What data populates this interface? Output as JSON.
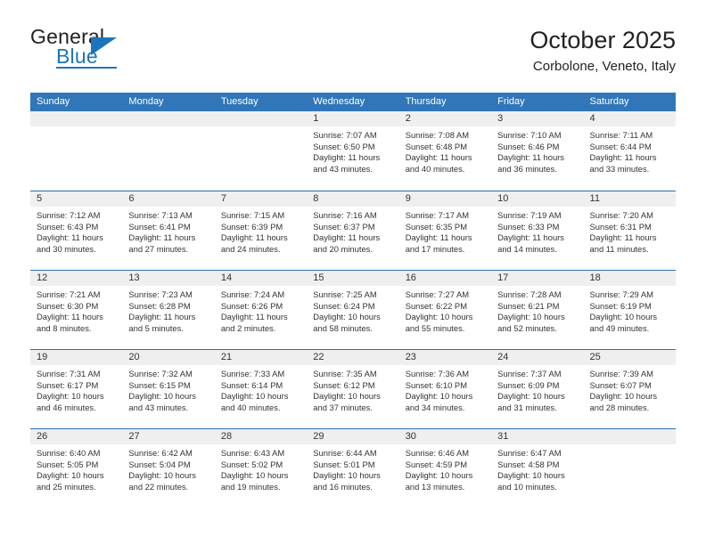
{
  "brand": {
    "name_part1": "General",
    "name_part2": "Blue",
    "triangle_icon": "triangle-icon",
    "accent_color": "#1c75bc"
  },
  "header": {
    "title": "October 2025",
    "subtitle": "Corbolone, Veneto, Italy"
  },
  "colors": {
    "weekday_header_bg": "#3076b8",
    "weekday_header_text": "#ffffff",
    "day_number_bg": "#efefef",
    "row_separator": "#2f6fa8",
    "body_text": "#333333"
  },
  "weekdays": [
    "Sunday",
    "Monday",
    "Tuesday",
    "Wednesday",
    "Thursday",
    "Friday",
    "Saturday"
  ],
  "weeks": [
    [
      {
        "day": "",
        "sunrise": "",
        "sunset": "",
        "daylight": "",
        "empty": true
      },
      {
        "day": "",
        "sunrise": "",
        "sunset": "",
        "daylight": "",
        "empty": true
      },
      {
        "day": "",
        "sunrise": "",
        "sunset": "",
        "daylight": "",
        "empty": true
      },
      {
        "day": "1",
        "sunrise": "Sunrise: 7:07 AM",
        "sunset": "Sunset: 6:50 PM",
        "daylight": "Daylight: 11 hours and 43 minutes."
      },
      {
        "day": "2",
        "sunrise": "Sunrise: 7:08 AM",
        "sunset": "Sunset: 6:48 PM",
        "daylight": "Daylight: 11 hours and 40 minutes."
      },
      {
        "day": "3",
        "sunrise": "Sunrise: 7:10 AM",
        "sunset": "Sunset: 6:46 PM",
        "daylight": "Daylight: 11 hours and 36 minutes."
      },
      {
        "day": "4",
        "sunrise": "Sunrise: 7:11 AM",
        "sunset": "Sunset: 6:44 PM",
        "daylight": "Daylight: 11 hours and 33 minutes."
      }
    ],
    [
      {
        "day": "5",
        "sunrise": "Sunrise: 7:12 AM",
        "sunset": "Sunset: 6:43 PM",
        "daylight": "Daylight: 11 hours and 30 minutes."
      },
      {
        "day": "6",
        "sunrise": "Sunrise: 7:13 AM",
        "sunset": "Sunset: 6:41 PM",
        "daylight": "Daylight: 11 hours and 27 minutes."
      },
      {
        "day": "7",
        "sunrise": "Sunrise: 7:15 AM",
        "sunset": "Sunset: 6:39 PM",
        "daylight": "Daylight: 11 hours and 24 minutes."
      },
      {
        "day": "8",
        "sunrise": "Sunrise: 7:16 AM",
        "sunset": "Sunset: 6:37 PM",
        "daylight": "Daylight: 11 hours and 20 minutes."
      },
      {
        "day": "9",
        "sunrise": "Sunrise: 7:17 AM",
        "sunset": "Sunset: 6:35 PM",
        "daylight": "Daylight: 11 hours and 17 minutes."
      },
      {
        "day": "10",
        "sunrise": "Sunrise: 7:19 AM",
        "sunset": "Sunset: 6:33 PM",
        "daylight": "Daylight: 11 hours and 14 minutes."
      },
      {
        "day": "11",
        "sunrise": "Sunrise: 7:20 AM",
        "sunset": "Sunset: 6:31 PM",
        "daylight": "Daylight: 11 hours and 11 minutes."
      }
    ],
    [
      {
        "day": "12",
        "sunrise": "Sunrise: 7:21 AM",
        "sunset": "Sunset: 6:30 PM",
        "daylight": "Daylight: 11 hours and 8 minutes."
      },
      {
        "day": "13",
        "sunrise": "Sunrise: 7:23 AM",
        "sunset": "Sunset: 6:28 PM",
        "daylight": "Daylight: 11 hours and 5 minutes."
      },
      {
        "day": "14",
        "sunrise": "Sunrise: 7:24 AM",
        "sunset": "Sunset: 6:26 PM",
        "daylight": "Daylight: 11 hours and 2 minutes."
      },
      {
        "day": "15",
        "sunrise": "Sunrise: 7:25 AM",
        "sunset": "Sunset: 6:24 PM",
        "daylight": "Daylight: 10 hours and 58 minutes."
      },
      {
        "day": "16",
        "sunrise": "Sunrise: 7:27 AM",
        "sunset": "Sunset: 6:22 PM",
        "daylight": "Daylight: 10 hours and 55 minutes."
      },
      {
        "day": "17",
        "sunrise": "Sunrise: 7:28 AM",
        "sunset": "Sunset: 6:21 PM",
        "daylight": "Daylight: 10 hours and 52 minutes."
      },
      {
        "day": "18",
        "sunrise": "Sunrise: 7:29 AM",
        "sunset": "Sunset: 6:19 PM",
        "daylight": "Daylight: 10 hours and 49 minutes."
      }
    ],
    [
      {
        "day": "19",
        "sunrise": "Sunrise: 7:31 AM",
        "sunset": "Sunset: 6:17 PM",
        "daylight": "Daylight: 10 hours and 46 minutes."
      },
      {
        "day": "20",
        "sunrise": "Sunrise: 7:32 AM",
        "sunset": "Sunset: 6:15 PM",
        "daylight": "Daylight: 10 hours and 43 minutes."
      },
      {
        "day": "21",
        "sunrise": "Sunrise: 7:33 AM",
        "sunset": "Sunset: 6:14 PM",
        "daylight": "Daylight: 10 hours and 40 minutes."
      },
      {
        "day": "22",
        "sunrise": "Sunrise: 7:35 AM",
        "sunset": "Sunset: 6:12 PM",
        "daylight": "Daylight: 10 hours and 37 minutes."
      },
      {
        "day": "23",
        "sunrise": "Sunrise: 7:36 AM",
        "sunset": "Sunset: 6:10 PM",
        "daylight": "Daylight: 10 hours and 34 minutes."
      },
      {
        "day": "24",
        "sunrise": "Sunrise: 7:37 AM",
        "sunset": "Sunset: 6:09 PM",
        "daylight": "Daylight: 10 hours and 31 minutes."
      },
      {
        "day": "25",
        "sunrise": "Sunrise: 7:39 AM",
        "sunset": "Sunset: 6:07 PM",
        "daylight": "Daylight: 10 hours and 28 minutes."
      }
    ],
    [
      {
        "day": "26",
        "sunrise": "Sunrise: 6:40 AM",
        "sunset": "Sunset: 5:05 PM",
        "daylight": "Daylight: 10 hours and 25 minutes."
      },
      {
        "day": "27",
        "sunrise": "Sunrise: 6:42 AM",
        "sunset": "Sunset: 5:04 PM",
        "daylight": "Daylight: 10 hours and 22 minutes."
      },
      {
        "day": "28",
        "sunrise": "Sunrise: 6:43 AM",
        "sunset": "Sunset: 5:02 PM",
        "daylight": "Daylight: 10 hours and 19 minutes."
      },
      {
        "day": "29",
        "sunrise": "Sunrise: 6:44 AM",
        "sunset": "Sunset: 5:01 PM",
        "daylight": "Daylight: 10 hours and 16 minutes."
      },
      {
        "day": "30",
        "sunrise": "Sunrise: 6:46 AM",
        "sunset": "Sunset: 4:59 PM",
        "daylight": "Daylight: 10 hours and 13 minutes."
      },
      {
        "day": "31",
        "sunrise": "Sunrise: 6:47 AM",
        "sunset": "Sunset: 4:58 PM",
        "daylight": "Daylight: 10 hours and 10 minutes."
      },
      {
        "day": "",
        "sunrise": "",
        "sunset": "",
        "daylight": "",
        "empty": true
      }
    ]
  ]
}
